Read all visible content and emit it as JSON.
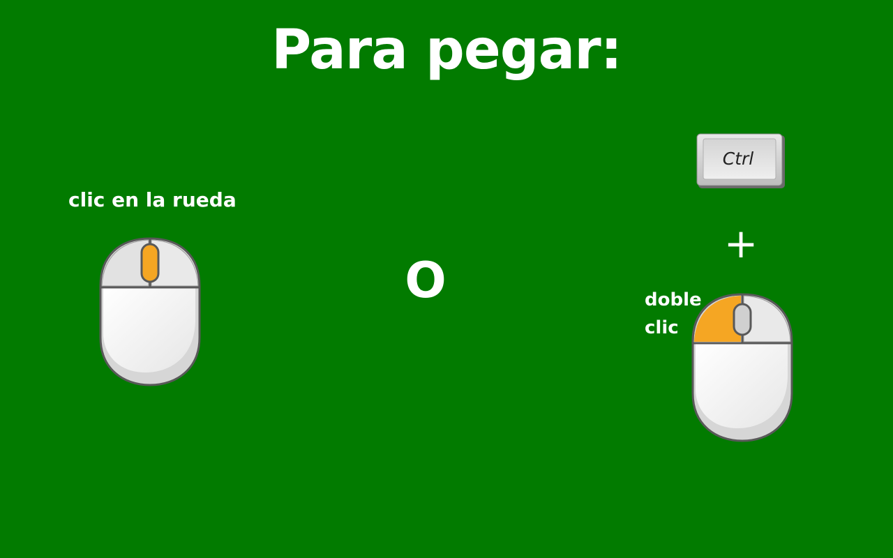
{
  "title": "Para pegar:",
  "left_option": {
    "label": "clic en la rueda",
    "icon": "mouse-wheel-click-icon",
    "highlight_color": "#f5a623"
  },
  "separator": "O",
  "right_option": {
    "key_label": "Ctrl",
    "plus": "+",
    "label_line1": "doble",
    "label_line2": "clic",
    "icon": "mouse-left-double-click-icon",
    "highlight_color": "#f5a623"
  },
  "colors": {
    "background": "#027b00",
    "text": "#ffffff",
    "highlight": "#f5a623"
  }
}
